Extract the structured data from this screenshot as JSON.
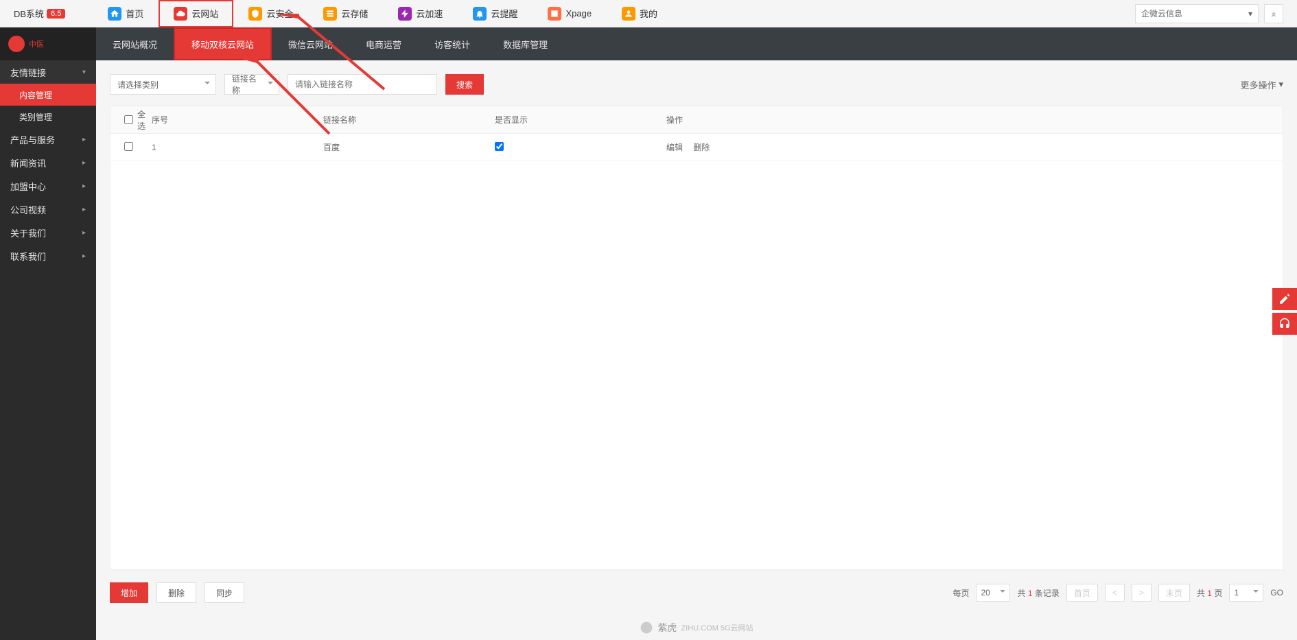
{
  "topbar": {
    "db_label": "DB系统",
    "db_version": "6.5",
    "items": [
      {
        "label": "首页",
        "icon": "home"
      },
      {
        "label": "云网站",
        "icon": "cloud",
        "highlighted": true
      },
      {
        "label": "云安全",
        "icon": "security"
      },
      {
        "label": "云存储",
        "icon": "storage"
      },
      {
        "label": "云加速",
        "icon": "speed"
      },
      {
        "label": "云提醒",
        "icon": "alert"
      },
      {
        "label": "Xpage",
        "icon": "xpage"
      },
      {
        "label": "我的",
        "icon": "user"
      }
    ],
    "right_dropdown": "企微云信息"
  },
  "sidebar": {
    "logo_text": "中医",
    "menu": [
      {
        "label": "友情链接",
        "expanded": true,
        "subs": [
          {
            "label": "内容管理",
            "active": true
          },
          {
            "label": "类别管理"
          }
        ]
      },
      {
        "label": "产品与服务"
      },
      {
        "label": "新闻资讯"
      },
      {
        "label": "加盟中心"
      },
      {
        "label": "公司视频"
      },
      {
        "label": "关于我们"
      },
      {
        "label": "联系我们"
      }
    ]
  },
  "subnav": {
    "items": [
      {
        "label": "云网站概况"
      },
      {
        "label": "移动双核云网站",
        "active": true
      },
      {
        "label": "微信云网站"
      },
      {
        "label": "电商运营"
      },
      {
        "label": "访客统计"
      },
      {
        "label": "数据库管理"
      }
    ]
  },
  "filters": {
    "category_placeholder": "请选择类别",
    "linkname_label": "链接名称",
    "search_placeholder": "请输入链接名称",
    "search_btn": "搜索",
    "more_ops": "更多操作"
  },
  "table": {
    "headers": {
      "select_all": "全选",
      "seq": "序号",
      "name": "链接名称",
      "show": "是否显示",
      "action": "操作"
    },
    "rows": [
      {
        "seq": "1",
        "name": "百度",
        "show": true,
        "edit": "编辑",
        "delete": "删除"
      }
    ]
  },
  "footer": {
    "add": "增加",
    "delete": "删除",
    "sync": "同步",
    "per_page_label": "每页",
    "per_page_value": "20",
    "total_prefix": "共",
    "total_count": "1",
    "total_suffix": "条记录",
    "first": "首页",
    "prev": "<",
    "next": ">",
    "last": "末页",
    "page_prefix": "共",
    "page_count": "1",
    "page_suffix": "页",
    "page_input": "1",
    "go": "GO"
  },
  "branding": {
    "name": "紫虎",
    "sub": "ZIHU.COM 5G云网站"
  }
}
